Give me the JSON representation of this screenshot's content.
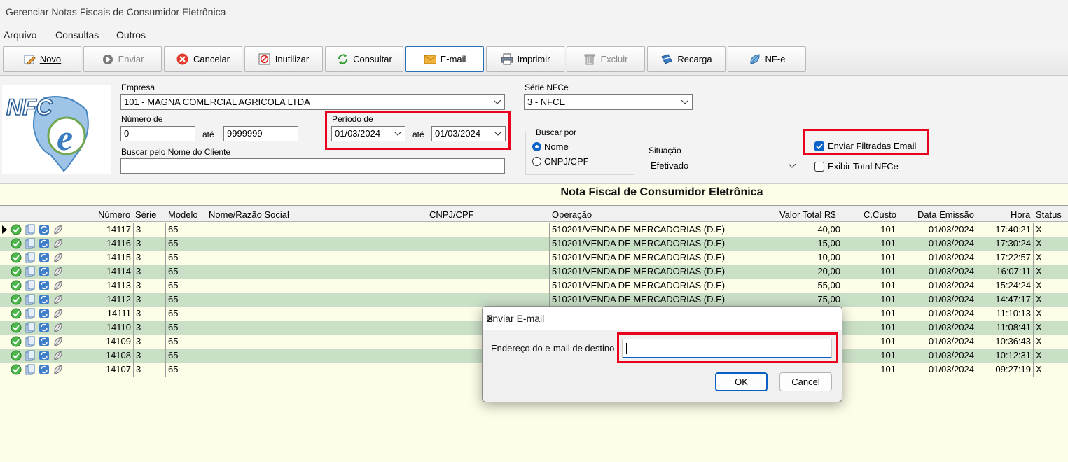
{
  "window": {
    "title": "Gerenciar Notas Fiscais de Consumidor Eletrônica"
  },
  "menu": [
    "Arquivo",
    "Consultas",
    "Outros"
  ],
  "toolbar": {
    "novo": "Novo",
    "enviar": "Enviar",
    "cancelar": "Cancelar",
    "inutilizar": "Inutilizar",
    "consultar": "Consultar",
    "email": "E-mail",
    "imprimir": "Imprimir",
    "excluir": "Excluir",
    "recarga": "Recarga",
    "nfe": "NF-e"
  },
  "logo": {
    "text": "NFC"
  },
  "filters": {
    "empresa_label": "Empresa",
    "empresa_value": "101 - MAGNA COMERCIAL AGRICOLA LTDA",
    "serie_label": "Série NFCe",
    "serie_value": "3 - NFCE",
    "numero_label": "Número de",
    "numero_from": "0",
    "ate": "até",
    "numero_to": "9999999",
    "periodo_label": "Período de",
    "periodo_from": "01/03/2024",
    "periodo_to": "01/03/2024",
    "cliente_label": "Buscar pelo Nome do Cliente",
    "cliente_value": "",
    "buscar_por_label": "Buscar por",
    "radio_nome": "Nome",
    "radio_cnpj": "CNPJ/CPF",
    "situacao_label": "Situação",
    "situacao_value": "Efetivado",
    "enviar_filtradas": "Enviar Filtradas Email",
    "exibir_total": "Exibir Total NFCe"
  },
  "grid": {
    "title": "Nota Fiscal de Consumidor Eletrônica",
    "headers": {
      "numero": "Número",
      "serie": "Série",
      "modelo": "Modelo",
      "nome": "Nome/Razão Social",
      "cnpj": "CNPJ/CPF",
      "operacao": "Operação",
      "valor": "Valor Total R$",
      "ccusto": "C.Custo",
      "data": "Data Emissão",
      "hora": "Hora",
      "status": "Status"
    },
    "rows": [
      {
        "numero": "14117",
        "serie": "3",
        "modelo": "65",
        "operacao": "510201/VENDA DE MERCADORIAS (D.E)",
        "valor": "40,00",
        "ccusto": "101",
        "data": "01/03/2024",
        "hora": "17:40:21",
        "status": "X"
      },
      {
        "numero": "14116",
        "serie": "3",
        "modelo": "65",
        "operacao": "510201/VENDA DE MERCADORIAS (D.E)",
        "valor": "15,00",
        "ccusto": "101",
        "data": "01/03/2024",
        "hora": "17:30:24",
        "status": "X"
      },
      {
        "numero": "14115",
        "serie": "3",
        "modelo": "65",
        "operacao": "510201/VENDA DE MERCADORIAS (D.E)",
        "valor": "10,00",
        "ccusto": "101",
        "data": "01/03/2024",
        "hora": "17:22:57",
        "status": "X"
      },
      {
        "numero": "14114",
        "serie": "3",
        "modelo": "65",
        "operacao": "510201/VENDA DE MERCADORIAS (D.E)",
        "valor": "20,00",
        "ccusto": "101",
        "data": "01/03/2024",
        "hora": "16:07:11",
        "status": "X"
      },
      {
        "numero": "14113",
        "serie": "3",
        "modelo": "65",
        "operacao": "510201/VENDA DE MERCADORIAS (D.E)",
        "valor": "55,00",
        "ccusto": "101",
        "data": "01/03/2024",
        "hora": "15:24:24",
        "status": "X"
      },
      {
        "numero": "14112",
        "serie": "3",
        "modelo": "65",
        "operacao": "510201/VENDA DE MERCADORIAS (D.E)",
        "valor": "75,00",
        "ccusto": "101",
        "data": "01/03/2024",
        "hora": "14:47:17",
        "status": "X"
      },
      {
        "numero": "14111",
        "serie": "3",
        "modelo": "65",
        "operacao": "",
        "valor": "",
        "ccusto": "101",
        "data": "01/03/2024",
        "hora": "11:10:13",
        "status": "X"
      },
      {
        "numero": "14110",
        "serie": "3",
        "modelo": "65",
        "operacao": "",
        "valor": "",
        "ccusto": "101",
        "data": "01/03/2024",
        "hora": "11:08:41",
        "status": "X"
      },
      {
        "numero": "14109",
        "serie": "3",
        "modelo": "65",
        "operacao": "",
        "valor": "",
        "ccusto": "101",
        "data": "01/03/2024",
        "hora": "10:36:43",
        "status": "X"
      },
      {
        "numero": "14108",
        "serie": "3",
        "modelo": "65",
        "operacao": "",
        "valor": "",
        "ccusto": "101",
        "data": "01/03/2024",
        "hora": "10:12:31",
        "status": "X"
      },
      {
        "numero": "14107",
        "serie": "3",
        "modelo": "65",
        "operacao": "",
        "valor": "",
        "ccusto": "101",
        "data": "01/03/2024",
        "hora": "09:27:19",
        "status": "X"
      }
    ]
  },
  "dialog": {
    "title": "Enviar E-mail",
    "close": "✕",
    "field_label": "Endereço do e-mail de destino",
    "field_value": "",
    "ok": "OK",
    "cancel": "Cancel"
  },
  "colors": {
    "highlight": "#e8001c",
    "row_alt": "#c9dfc6",
    "row_base": "#fdfde8",
    "accent": "#0a64c8"
  }
}
